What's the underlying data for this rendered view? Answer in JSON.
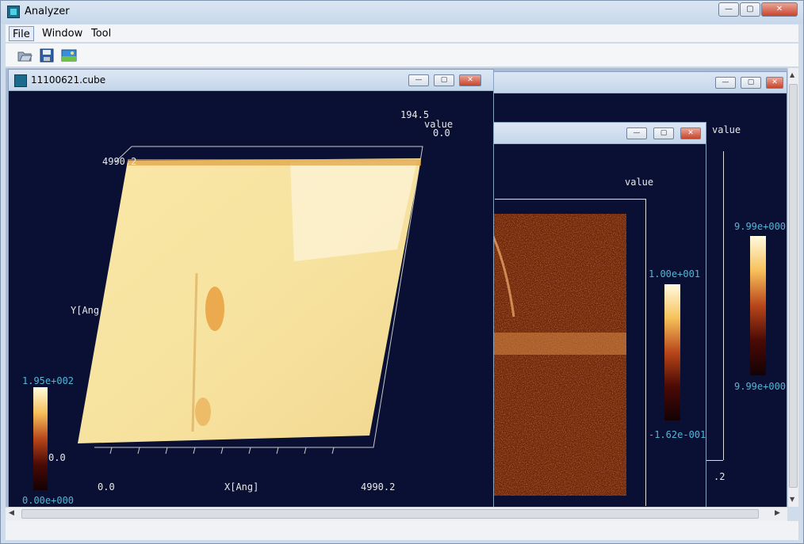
{
  "app": {
    "title": "Analyzer"
  },
  "window_controls": {
    "minimize": "—",
    "maximize": "▢",
    "close": "✕"
  },
  "menu": {
    "file": "File",
    "window": "Window",
    "tool": "Tool"
  },
  "toolbar": {
    "open_icon": "folder-open-icon",
    "save_icon": "save-disk-icon",
    "image_icon": "image-icon"
  },
  "windows": {
    "front": {
      "title": "11100621.cube",
      "value_max": "194.5",
      "value_label": "value",
      "value_zero": "0.0",
      "y_max": "4990.2",
      "y_axis_label": "Y[Ang",
      "x_min": "0.0",
      "x_axis_label": "X[Ang]",
      "x_max": "4990.2",
      "z_bottom": "0.0",
      "colorbar_max": "1.95e+002",
      "colorbar_min": "0.00e+000"
    },
    "middle": {
      "value_label": "value",
      "colorbar_max": "1.00e+001",
      "colorbar_min": "-1.62e-001"
    },
    "back": {
      "value_label": "value",
      "colorbar_max": "9.99e+000",
      "colorbar_min": "9.99e+000",
      "axis_end": ".2"
    }
  }
}
